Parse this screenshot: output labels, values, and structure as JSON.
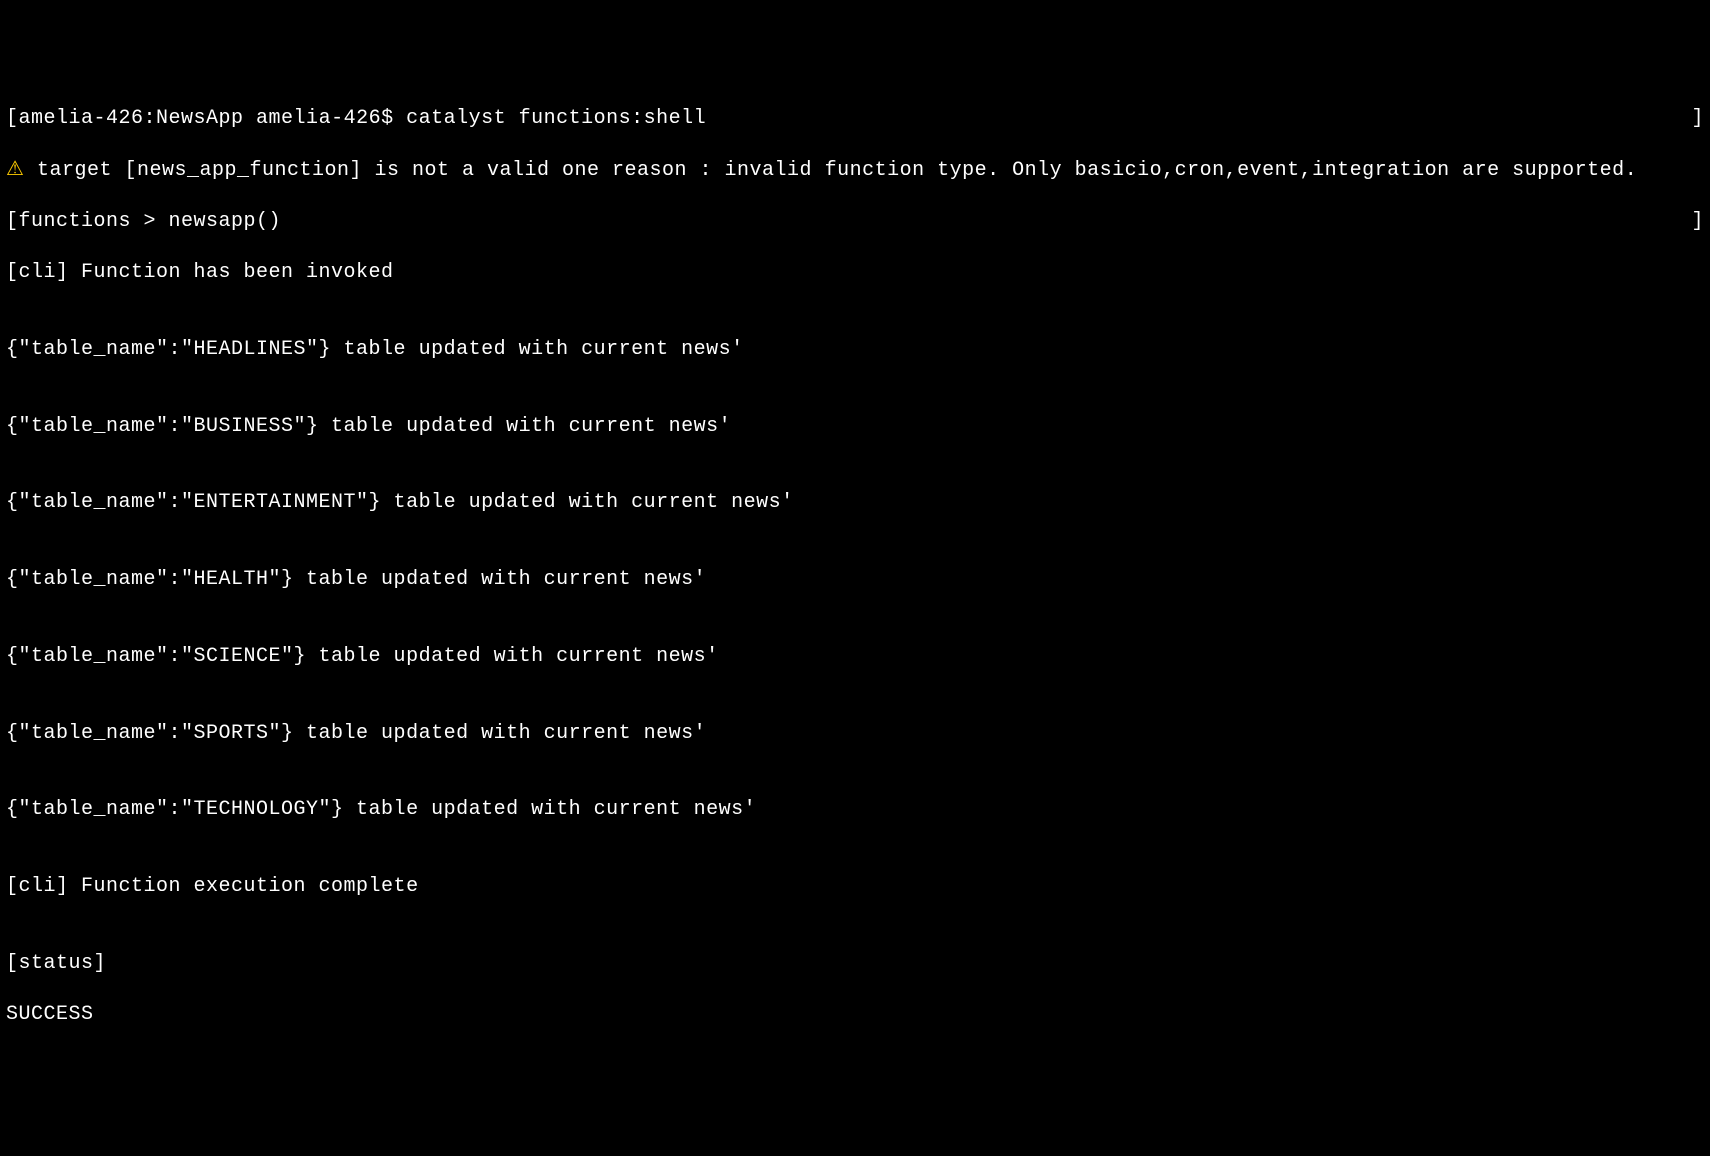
{
  "prompt": {
    "open_bracket": "[",
    "host_path": "amelia-426:NewsApp amelia-426$ ",
    "command": "catalyst functions:shell",
    "close_bracket": "]"
  },
  "warning": {
    "icon": "⚠",
    "text": " target [news_app_function] is not a valid one reason : invalid function type. Only basicio,cron,event,integration are supported."
  },
  "shell_prompt": {
    "open_bracket": "[",
    "text": "functions > newsapp()",
    "close_bracket": "]"
  },
  "cli_invoke": "[cli] Function has been invoked",
  "blank": "",
  "updates": [
    "{\"table_name\":\"HEADLINES\"} table updated with current news'",
    "{\"table_name\":\"BUSINESS\"} table updated with current news'",
    "{\"table_name\":\"ENTERTAINMENT\"} table updated with current news'",
    "{\"table_name\":\"HEALTH\"} table updated with current news'",
    "{\"table_name\":\"SCIENCE\"} table updated with current news'",
    "{\"table_name\":\"SPORTS\"} table updated with current news'",
    "{\"table_name\":\"TECHNOLOGY\"} table updated with current news'"
  ],
  "cli_complete": "[cli] Function execution complete",
  "status_label": "[status]",
  "status_value": "SUCCESS"
}
